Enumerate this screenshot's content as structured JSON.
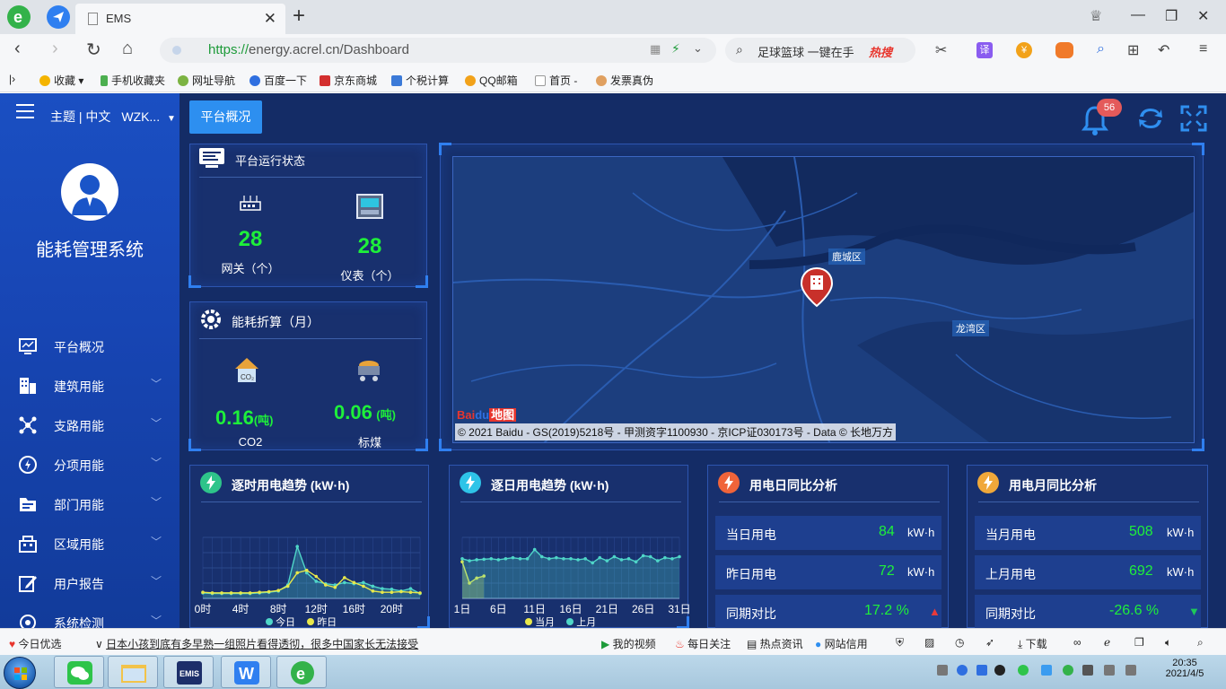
{
  "browser": {
    "tab_title": "EMS",
    "url_prefix": "https://",
    "url_rest": "energy.acrel.cn/Dashboard",
    "search_query": "足球篮球 一键在手",
    "search_hot": "热搜",
    "translate_label": "译"
  },
  "bookmarks": [
    "收藏",
    "手机收藏夹",
    "网址导航",
    "百度一下",
    "京东商城",
    "个税计算",
    "QQ邮箱",
    "首页 -",
    "发票真伪"
  ],
  "app": {
    "top_label": "主题 | 中文",
    "user": "WZK...",
    "system_title": "能耗管理系统",
    "active_tab": "平台概况",
    "notifications": "56",
    "menu": [
      {
        "label": "平台概况",
        "icon": "monitor-icon",
        "chevron": ""
      },
      {
        "label": "建筑用能",
        "icon": "building-icon",
        "chevron": "﹀"
      },
      {
        "label": "支路用能",
        "icon": "branch-icon",
        "chevron": "﹀"
      },
      {
        "label": "分项用能",
        "icon": "lightning-icon",
        "chevron": "﹀"
      },
      {
        "label": "部门用能",
        "icon": "folder-icon",
        "chevron": "﹀"
      },
      {
        "label": "区域用能",
        "icon": "region-icon",
        "chevron": "﹀"
      },
      {
        "label": "用户报告",
        "icon": "edit-icon",
        "chevron": "﹀"
      },
      {
        "label": "系统检测",
        "icon": "check-icon",
        "chevron": "﹀"
      }
    ]
  },
  "platform_status": {
    "title": "平台运行状态",
    "gateway_count": "28",
    "gateway_label": "网关（个）",
    "meter_count": "28",
    "meter_label": "仪表（个）"
  },
  "energy_conversion": {
    "title": "能耗折算（月）",
    "co2_value": "0.16",
    "co2_unit": "(吨)",
    "co2_label": "CO2",
    "coal_value": "0.06",
    "coal_unit": "(吨)",
    "coal_label": "标煤"
  },
  "map": {
    "labels": [
      "鹿城区",
      "龙湾区"
    ],
    "copyright": "© 2021 Baidu - GS(2019)5218号 - 甲测资字1100930 - 京ICP证030173号 - Data © 长地万方",
    "logo_text": "Bai",
    "logo_text2": "地图"
  },
  "hourly_trend": {
    "title": "逐时用电趋势 (kW·h)",
    "legend": [
      "今日",
      "昨日"
    ]
  },
  "daily_trend": {
    "title": "逐日用电趋势 (kW·h)",
    "legend": [
      "当月",
      "上月"
    ]
  },
  "daily_compare": {
    "title": "用电日同比分析",
    "rows": [
      {
        "label": "当日用电",
        "value": "84",
        "unit": "kW·h"
      },
      {
        "label": "昨日用电",
        "value": "72",
        "unit": "kW·h"
      },
      {
        "label": "同期对比",
        "value": "17.2 %",
        "unit": "▲"
      }
    ]
  },
  "monthly_compare": {
    "title": "用电月同比分析",
    "rows": [
      {
        "label": "当月用电",
        "value": "508",
        "unit": "kW·h"
      },
      {
        "label": "上月用电",
        "value": "692",
        "unit": "kW·h"
      },
      {
        "label": "同期对比",
        "value": "-26.6 %",
        "unit": "▼"
      }
    ]
  },
  "chart_data": [
    {
      "type": "line",
      "title": "逐时用电趋势 (kW·h)",
      "categories": [
        "0时",
        "1时",
        "2时",
        "3时",
        "4时",
        "5时",
        "6时",
        "7时",
        "8时",
        "9时",
        "10时",
        "11时",
        "12时",
        "13时",
        "14时",
        "15时",
        "16时",
        "17时",
        "18时",
        "19时",
        "20时",
        "21时",
        "22时",
        "23时"
      ],
      "tick_labels": [
        "0时",
        "4时",
        "8时",
        "12时",
        "16时",
        "20时"
      ],
      "series": [
        {
          "name": "今日",
          "values": [
            0.9,
            0.8,
            0.8,
            0.8,
            0.8,
            0.8,
            0.9,
            1.0,
            1.2,
            2.2,
            8.5,
            4.2,
            2.8,
            2.4,
            2.2,
            2.6,
            2.4,
            2.6,
            2.0,
            1.6,
            1.5,
            1.2,
            1.6,
            0.8
          ]
        },
        {
          "name": "昨日",
          "values": [
            1.0,
            0.9,
            0.9,
            0.9,
            0.9,
            0.9,
            1.0,
            1.1,
            1.3,
            2.0,
            4.2,
            4.6,
            3.6,
            2.2,
            1.8,
            3.4,
            2.6,
            2.0,
            1.2,
            1.0,
            1.0,
            1.1,
            1.0,
            0.9
          ]
        }
      ],
      "ylim": [
        0,
        10
      ],
      "grid": true
    },
    {
      "type": "area",
      "title": "逐日用电趋势 (kW·h)",
      "categories": [
        "1日",
        "2日",
        "3日",
        "4日",
        "5日",
        "6日",
        "7日",
        "8日",
        "9日",
        "10日",
        "11日",
        "12日",
        "13日",
        "14日",
        "15日",
        "16日",
        "17日",
        "18日",
        "19日",
        "20日",
        "21日",
        "22日",
        "23日",
        "24日",
        "25日",
        "26日",
        "27日",
        "28日",
        "29日",
        "30日",
        "31日"
      ],
      "tick_labels": [
        "1日",
        "6日",
        "11日",
        "16日",
        "21日",
        "26日",
        "31日"
      ],
      "series": [
        {
          "name": "当月",
          "values": [
            72,
            30,
            40,
            44
          ]
        },
        {
          "name": "上月",
          "values": [
            78,
            74,
            76,
            77,
            78,
            76,
            78,
            80,
            78,
            78,
            96,
            82,
            78,
            80,
            78,
            78,
            76,
            78,
            70,
            80,
            74,
            82,
            76,
            78,
            72,
            84,
            82,
            74,
            80,
            78,
            82
          ]
        }
      ],
      "ylim": [
        0,
        120
      ],
      "grid": true
    }
  ]
}
